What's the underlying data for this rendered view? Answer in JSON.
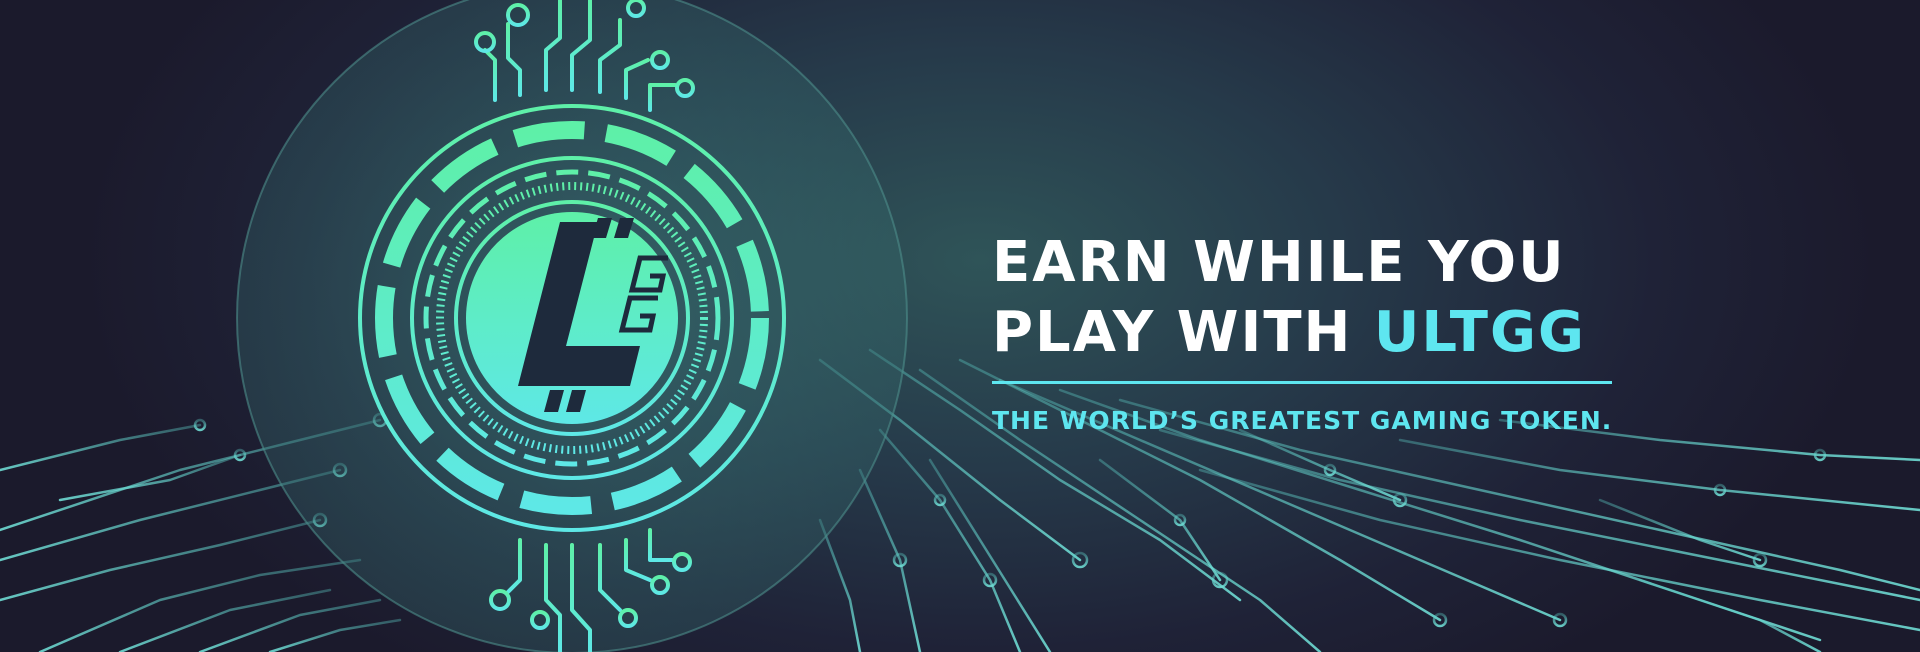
{
  "banner": {
    "headline_line1": "EARN WHILE YOU",
    "headline_line2_prefix": "PLAY WITH ",
    "headline_line2_accent": "ULTGG",
    "tagline": "THE WORLD’S GREATEST GAMING TOKEN."
  },
  "colors": {
    "background_dark": "#1c1a2e",
    "accent_cyan": "#5ee6f0",
    "coin_green": "#5ef0b0",
    "circuit_line": "#6fd7d0",
    "text_white": "#ffffff"
  },
  "icons": [
    "ultgg-coin-icon",
    "circuit-board-pattern"
  ]
}
